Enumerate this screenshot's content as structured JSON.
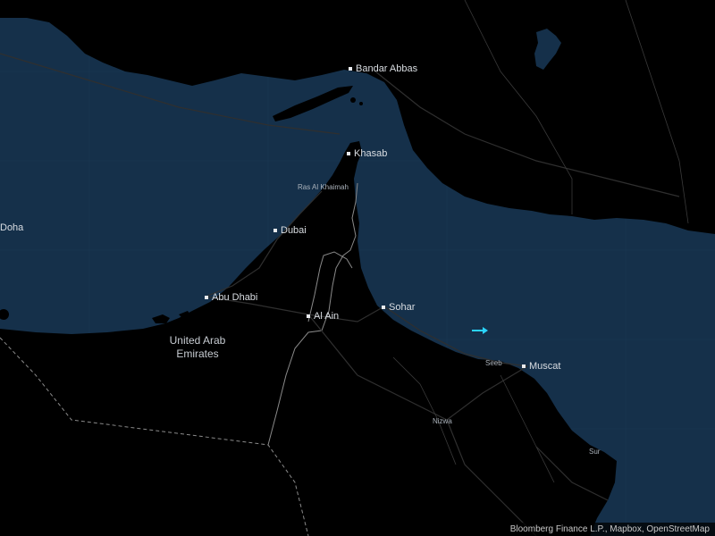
{
  "colors": {
    "water": "#15304a",
    "land": "#000000",
    "border": "#8a8a8a",
    "road": "#2b2b2b",
    "marker": "#2ad4ff"
  },
  "cities": {
    "bandar_abbas": "Bandar Abbas",
    "khasab": "Khasab",
    "dubai": "Dubai",
    "abu_dhabi": "Abu Dhabi",
    "al_ain": "Al Ain",
    "sohar": "Sohar",
    "muscat": "Muscat",
    "doha": "Doha"
  },
  "places": {
    "ras_al_khaimah": "Ras Al Khaimah",
    "seeb": "Seeb",
    "nizwa": "Nizwa",
    "sur": "Sur"
  },
  "country": {
    "line1": "United Arab",
    "line2": "Emirates"
  },
  "attribution": "Bloomberg Finance L.P., Mapbox, OpenStreetMap",
  "marker": {
    "icon": "arrow-right-icon"
  }
}
